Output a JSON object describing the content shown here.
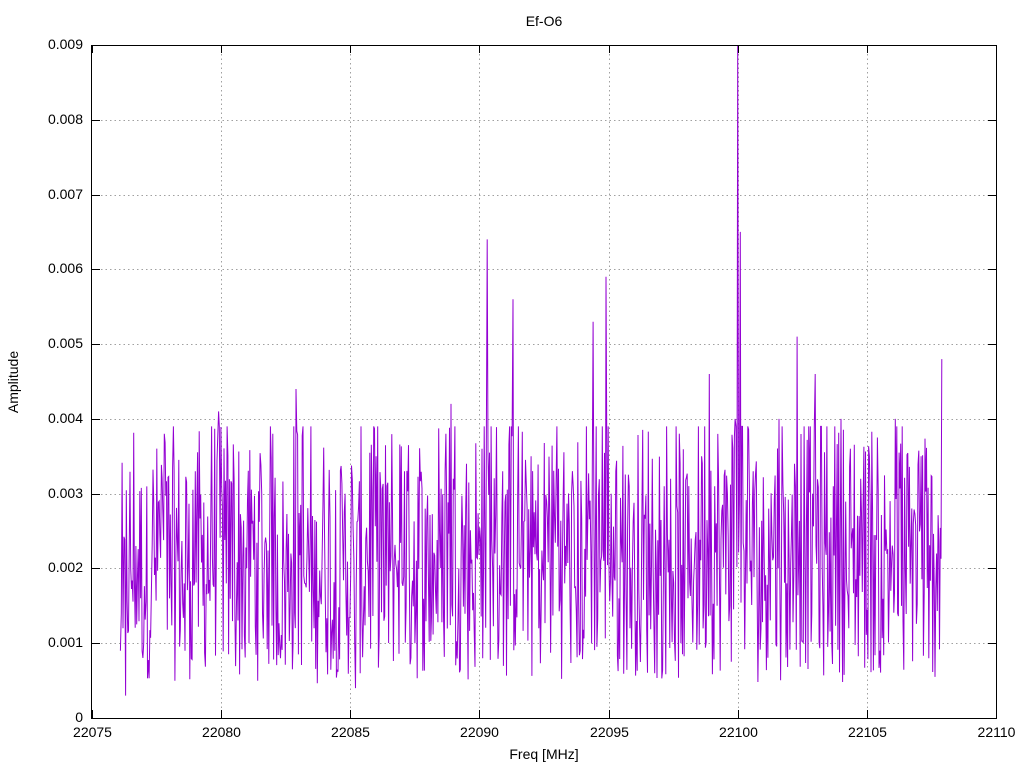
{
  "chart_data": {
    "type": "line",
    "title": "Ef-O6",
    "xlabel": "Freq [MHz]",
    "ylabel": "Amplitude",
    "xlim": [
      22075,
      22110
    ],
    "ylim": [
      0,
      0.009
    ],
    "x_ticks": [
      "22075",
      "22080",
      "22085",
      "22090",
      "22095",
      "22100",
      "22105",
      "22110"
    ],
    "y_ticks": [
      "0",
      "0.001",
      "0.002",
      "0.003",
      "0.004",
      "0.005",
      "0.006",
      "0.007",
      "0.008",
      "0.009"
    ],
    "grid": true,
    "legend": "none",
    "series": [
      {
        "color": "#9400d3",
        "x_start": 22076.1,
        "x_end": 22107.9,
        "points": [
          [
            22076.1,
            0.0009
          ],
          [
            22076.2,
            0.0012
          ],
          [
            22076.3,
            0.0003
          ],
          [
            22076.5,
            0.002
          ],
          [
            22076.7,
            0.0023
          ],
          [
            22077.0,
            0.001
          ],
          [
            22077.3,
            0.0017
          ],
          [
            22077.6,
            0.0029
          ],
          [
            22077.8,
            0.0038
          ],
          [
            22078.0,
            0.0016
          ],
          [
            22078.3,
            0.0024
          ],
          [
            22078.6,
            0.0009
          ],
          [
            22079.0,
            0.0033
          ],
          [
            22079.3,
            0.0015
          ],
          [
            22079.6,
            0.0027
          ],
          [
            22079.9,
            0.0041
          ],
          [
            22080.2,
            0.0018
          ],
          [
            22080.5,
            0.0032
          ],
          [
            22080.9,
            0.0011
          ],
          [
            22081.2,
            0.0026
          ],
          [
            22081.6,
            0.0014
          ],
          [
            22082.0,
            0.0038
          ],
          [
            22082.3,
            0.0008
          ],
          [
            22082.7,
            0.0022
          ],
          [
            22082.9,
            0.0044
          ],
          [
            22083.2,
            0.0019
          ],
          [
            22083.6,
            0.0012
          ],
          [
            22084.0,
            0.0025
          ],
          [
            22084.4,
            0.0009
          ],
          [
            22084.8,
            0.003
          ],
          [
            22085.2,
            0.0004
          ],
          [
            22085.6,
            0.0024
          ],
          [
            22086.0,
            0.0035
          ],
          [
            22086.3,
            0.0013
          ],
          [
            22086.7,
            0.0021
          ],
          [
            22087.1,
            0.0033
          ],
          [
            22087.5,
            0.001
          ],
          [
            22087.9,
            0.0028
          ],
          [
            22088.3,
            0.0017
          ],
          [
            22088.7,
            0.0038
          ],
          [
            22088.9,
            0.0042
          ],
          [
            22089.2,
            0.002
          ],
          [
            22089.5,
            0.0034
          ],
          [
            22089.8,
            0.0011
          ],
          [
            22090.1,
            0.0036
          ],
          [
            22090.3,
            0.0064
          ],
          [
            22090.6,
            0.0022
          ],
          [
            22090.9,
            0.0033
          ],
          [
            22091.2,
            0.0015
          ],
          [
            22091.3,
            0.0056
          ],
          [
            22091.6,
            0.002
          ],
          [
            22092.0,
            0.0035
          ],
          [
            22092.3,
            0.0012
          ],
          [
            22092.6,
            0.0029
          ],
          [
            22093.0,
            0.0039
          ],
          [
            22093.3,
            0.0018
          ],
          [
            22093.6,
            0.0033
          ],
          [
            22093.9,
            0.0009
          ],
          [
            22094.2,
            0.0027
          ],
          [
            22094.4,
            0.0053
          ],
          [
            22094.7,
            0.0021
          ],
          [
            22094.9,
            0.0059
          ],
          [
            22095.1,
            0.003
          ],
          [
            22095.4,
            0.0016
          ],
          [
            22095.8,
            0.0031
          ],
          [
            22096.2,
            0.0012
          ],
          [
            22096.6,
            0.0026
          ],
          [
            22097.0,
            0.0019
          ],
          [
            22097.4,
            0.0032
          ],
          [
            22097.8,
            0.001
          ],
          [
            22098.2,
            0.0024
          ],
          [
            22098.6,
            0.0035
          ],
          [
            22098.9,
            0.0046
          ],
          [
            22099.2,
            0.0015
          ],
          [
            22099.6,
            0.003
          ],
          [
            22099.9,
            0.004
          ],
          [
            22100.0,
            0.009
          ],
          [
            22100.1,
            0.0065
          ],
          [
            22100.3,
            0.002
          ],
          [
            22100.6,
            0.0033
          ],
          [
            22100.9,
            0.0012
          ],
          [
            22101.2,
            0.0028
          ],
          [
            22101.6,
            0.004
          ],
          [
            22101.9,
            0.0018
          ],
          [
            22102.2,
            0.0034
          ],
          [
            22102.3,
            0.0051
          ],
          [
            22102.6,
            0.0022
          ],
          [
            22102.9,
            0.003
          ],
          [
            22103.0,
            0.0046
          ],
          [
            22103.3,
            0.0015
          ],
          [
            22103.7,
            0.0031
          ],
          [
            22104.0,
            0.004
          ],
          [
            22104.3,
            0.0012
          ],
          [
            22104.7,
            0.0027
          ],
          [
            22105.1,
            0.0035
          ],
          [
            22105.5,
            0.0009
          ],
          [
            22105.9,
            0.0029
          ],
          [
            22106.1,
            0.004
          ],
          [
            22106.4,
            0.0013
          ],
          [
            22106.8,
            0.0026
          ],
          [
            22107.1,
            0.0035
          ],
          [
            22107.4,
            0.0008
          ],
          [
            22107.7,
            0.0022
          ],
          [
            22107.9,
            0.0048
          ]
        ]
      }
    ]
  }
}
